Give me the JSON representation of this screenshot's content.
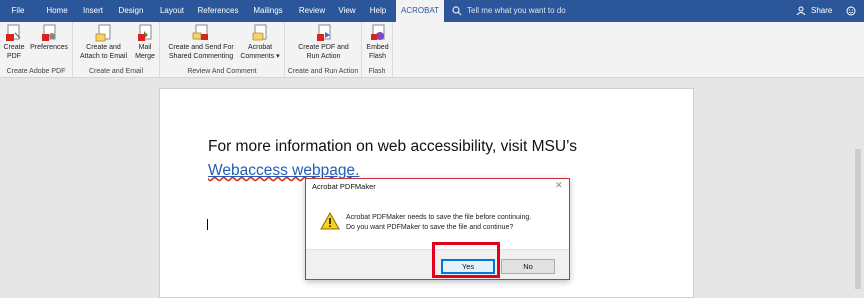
{
  "tabs": [
    "File",
    "Home",
    "Insert",
    "Design",
    "Layout",
    "References",
    "Mailings",
    "Review",
    "View",
    "Help",
    "ACROBAT"
  ],
  "active_tab": "ACROBAT",
  "tell_me": "Tell me what you want to do",
  "share": "Share",
  "ribbon": {
    "groups": [
      {
        "label": "Create Adobe PDF",
        "buttons": [
          {
            "label1": "Create",
            "label2": "PDF",
            "icon": "create-pdf-icon"
          },
          {
            "label1": "Preferences",
            "label2": "",
            "icon": "preferences-icon"
          }
        ]
      },
      {
        "label": "Create and Email",
        "buttons": [
          {
            "label1": "Create and",
            "label2": "Attach to Email",
            "icon": "attach-email-icon"
          },
          {
            "label1": "Mail",
            "label2": "Merge",
            "icon": "mail-merge-icon"
          }
        ]
      },
      {
        "label": "Review And Comment",
        "buttons": [
          {
            "label1": "Create and Send For",
            "label2": "Shared Commenting",
            "icon": "shared-commenting-icon"
          },
          {
            "label1": "Acrobat",
            "label2": "Comments ▾",
            "icon": "acrobat-comments-icon"
          }
        ]
      },
      {
        "label": "Create and Run Action",
        "buttons": [
          {
            "label1": "Create PDF and",
            "label2": "Run Action",
            "icon": "run-action-icon"
          }
        ]
      },
      {
        "label": "Flash",
        "buttons": [
          {
            "label1": "Embed",
            "label2": "Flash",
            "icon": "embed-flash-icon"
          }
        ]
      }
    ]
  },
  "document": {
    "line1": "For more information on web accessibility, visit MSU’s",
    "link_text": "Webaccess webpage",
    "link_suffix": "."
  },
  "dialog": {
    "title": "Acrobat PDFMaker",
    "close": "✕",
    "message_line1": "Acrobat PDFMaker needs to save the file before continuing.",
    "message_line2": "Do you want PDFMaker to save the file and continue?",
    "yes_label": "Yes",
    "no_label": "No"
  },
  "colors": {
    "ribbon_tab_bar": "#2b579a",
    "highlight_box": "#e3001b",
    "link": "#1f5fb4"
  }
}
